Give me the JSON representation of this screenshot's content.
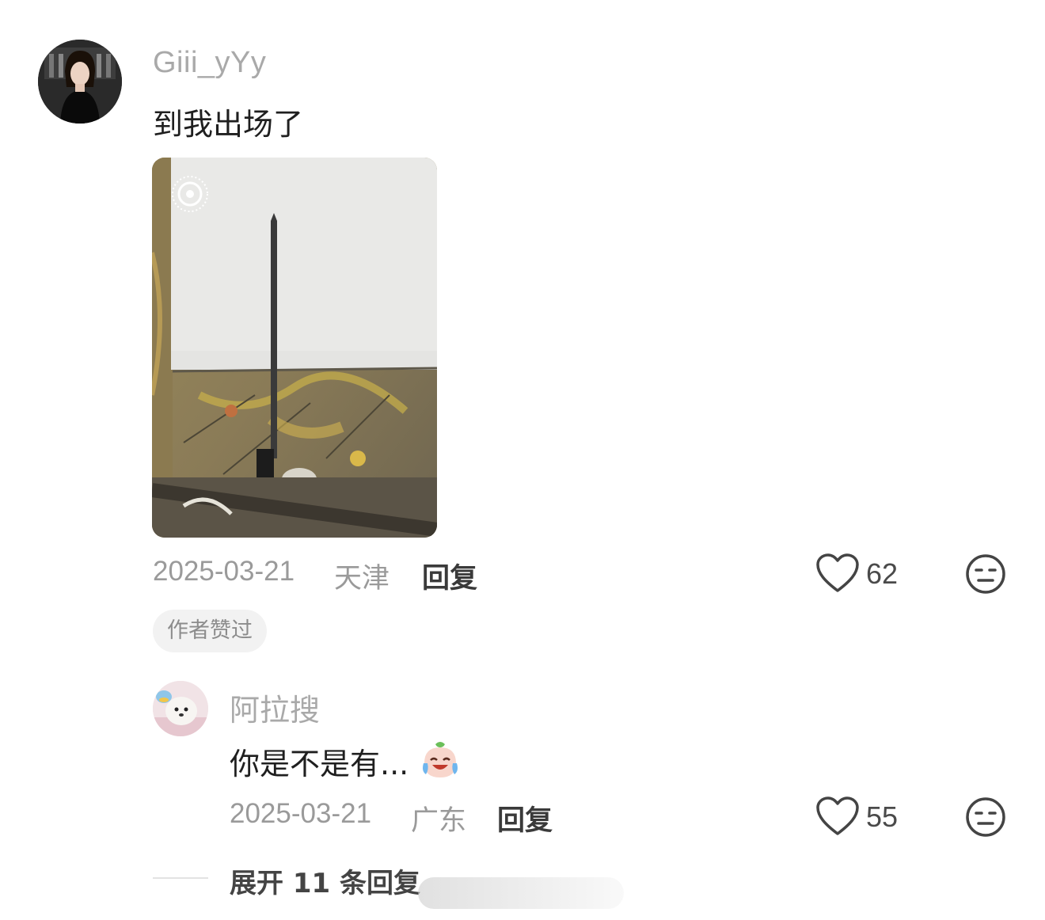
{
  "comment": {
    "username": "Giii_yYy",
    "text": "到我出场了",
    "date": "2025-03-21",
    "location": "天津",
    "reply_label": "回复",
    "likes": "62",
    "author_badge": "作者赞过"
  },
  "sub_comment": {
    "username": "阿拉搜",
    "text": "你是不是有...",
    "date": "2025-03-21",
    "location": "广东",
    "reply_label": "回复",
    "likes": "55"
  },
  "expand_label": "展开 11 条回复"
}
